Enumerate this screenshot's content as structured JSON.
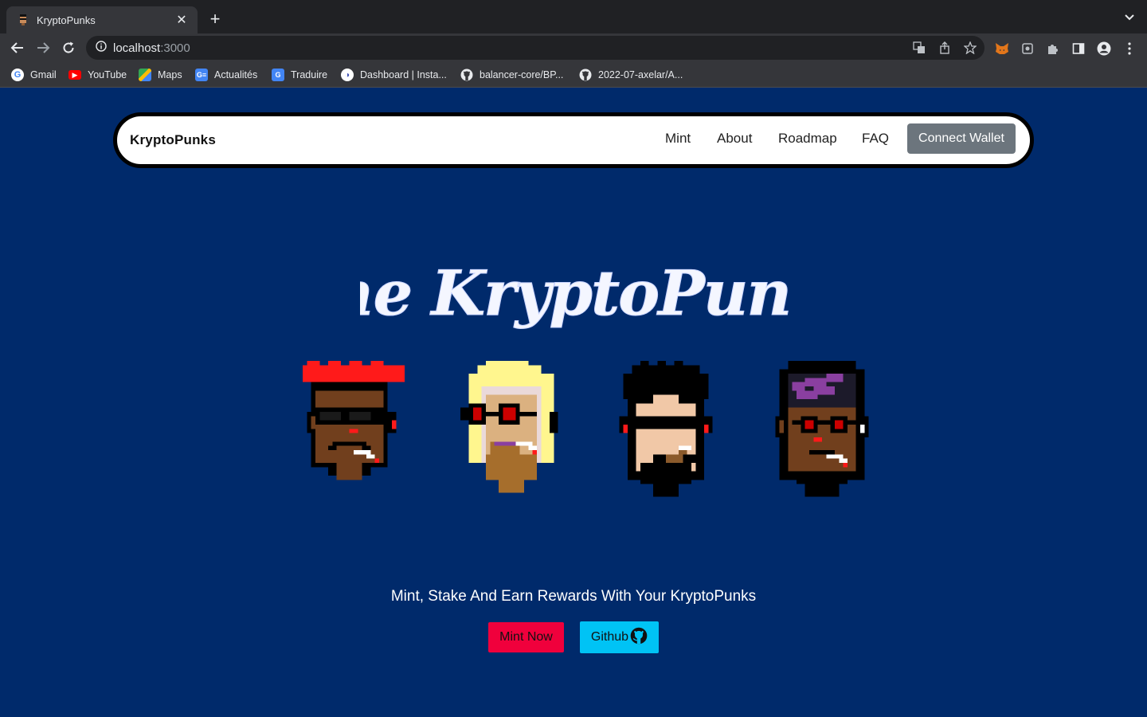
{
  "browser": {
    "tab": {
      "title": "KryptoPunks"
    },
    "address": {
      "host": "localhost",
      "port": ":3000"
    },
    "bookmarks": [
      {
        "label": "Gmail",
        "icon": "google-icon"
      },
      {
        "label": "YouTube",
        "icon": "youtube-icon"
      },
      {
        "label": "Maps",
        "icon": "maps-icon"
      },
      {
        "label": "Actualités",
        "icon": "news-icon"
      },
      {
        "label": "Traduire",
        "icon": "translate-icon"
      },
      {
        "label": "Dashboard | Insta...",
        "icon": "dashboard-icon"
      },
      {
        "label": "balancer-core/BP...",
        "icon": "github-icon"
      },
      {
        "label": "2022-07-axelar/A...",
        "icon": "github-icon"
      }
    ]
  },
  "navbar": {
    "brand": "KryptoPunks",
    "links": [
      "Mint",
      "About",
      "Roadmap",
      "FAQ"
    ],
    "connect_label": "Connect Wallet"
  },
  "hero": {
    "title": "The KryptoPunks",
    "tagline": "Mint, Stake And Earn Rewards With Your KryptoPunks",
    "mint_label": "Mint Now",
    "github_label": "Github"
  },
  "colors": {
    "page_bg": "#002a6b",
    "mint_button": "#f0003c",
    "github_button": "#00c3f5",
    "connect_button": "#6c757d"
  }
}
